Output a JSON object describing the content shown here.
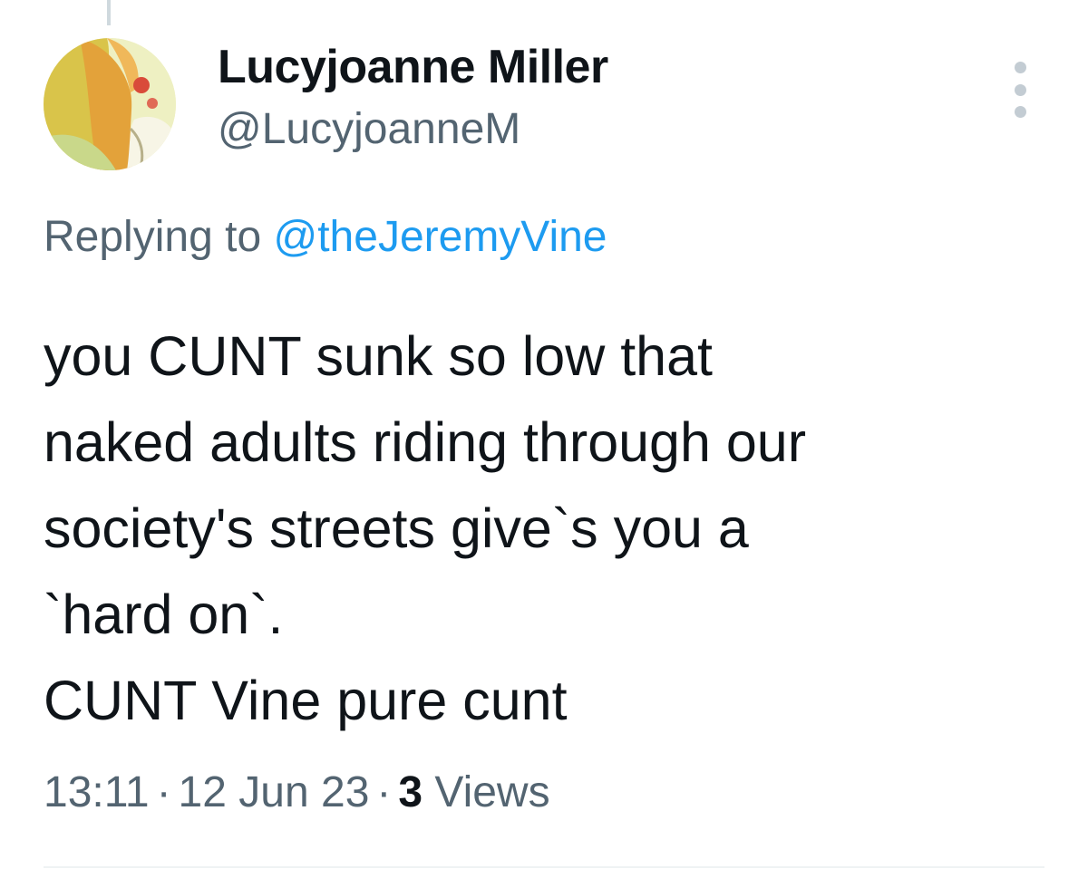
{
  "author": {
    "display_name": "Lucyjoanne Miller",
    "handle": "@LucyjoanneM"
  },
  "more_icon": "more-vertical-icon",
  "reply": {
    "prefix": "Replying to",
    "target": "@theJeremyVine"
  },
  "tweet": {
    "lines": [
      "you CUNT sunk so low that",
      "naked adults riding through our",
      "society's streets give`s you a",
      "`hard on`.",
      "CUNT Vine pure cunt"
    ]
  },
  "meta": {
    "time": "13:11",
    "separator": "·",
    "date": "12 Jun 23",
    "views_count": "3",
    "views_label": "Views"
  },
  "colors": {
    "text": "#0f1419",
    "secondary": "#536471",
    "link": "#1d9bf0"
  }
}
